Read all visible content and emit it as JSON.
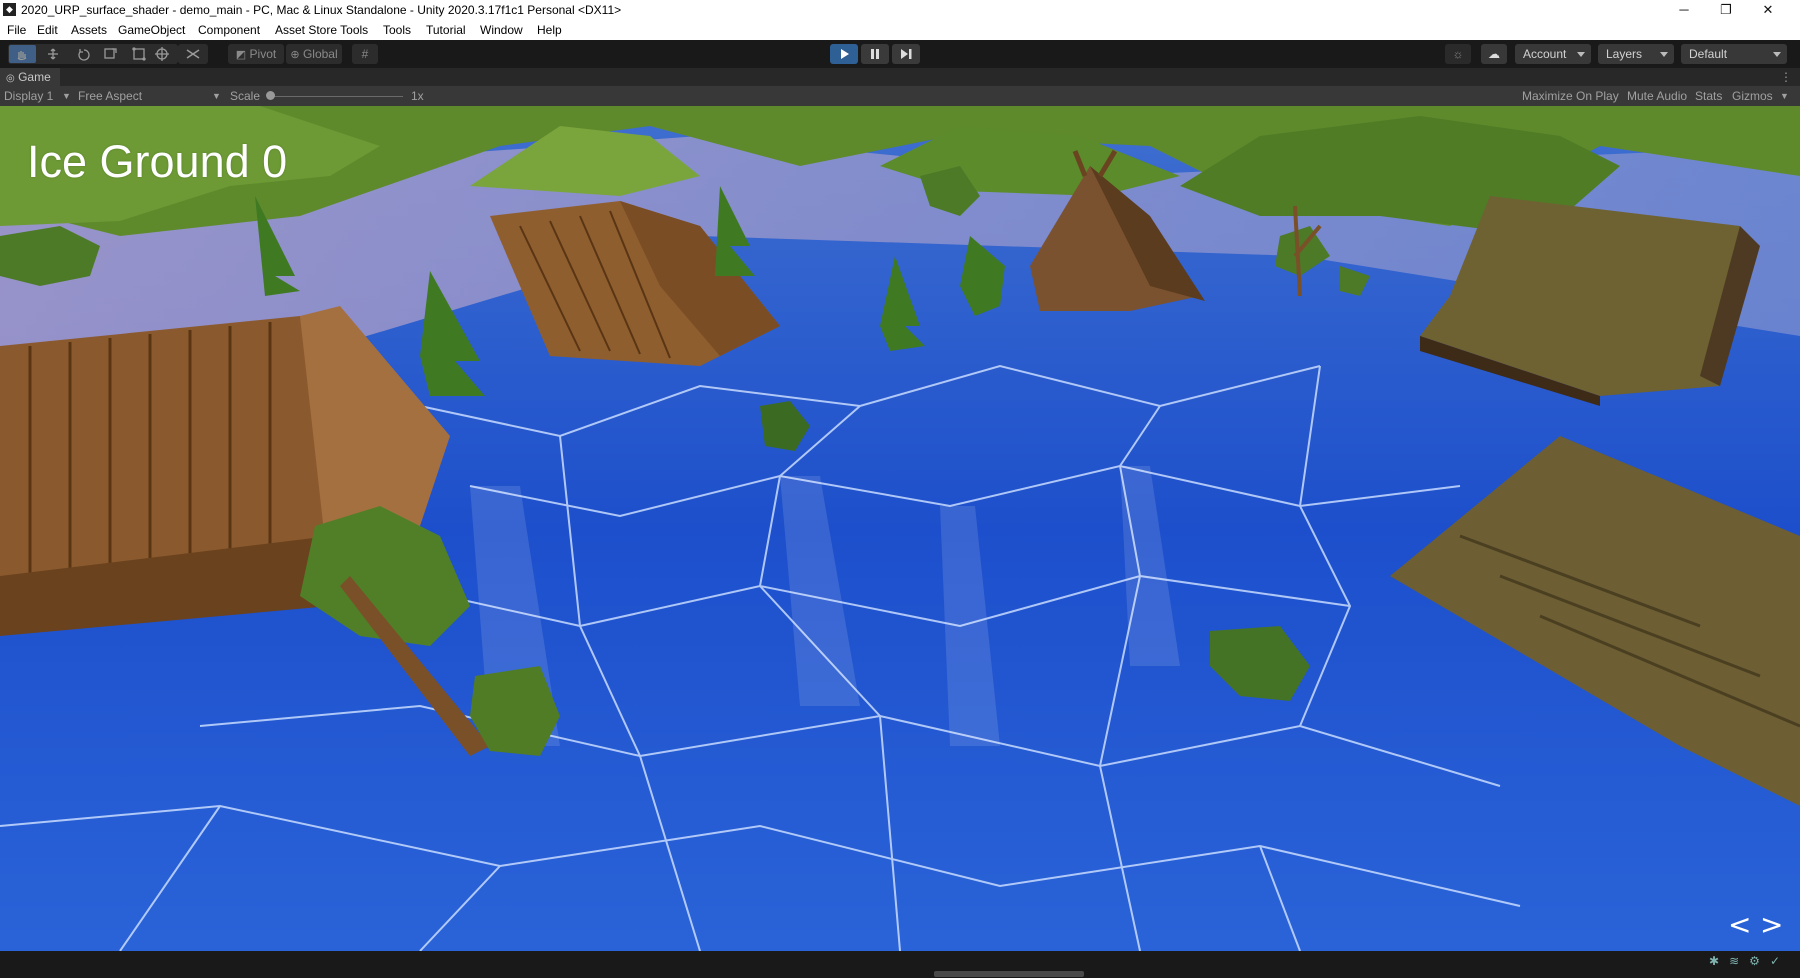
{
  "window": {
    "title": "2020_URP_surface_shader - demo_main - PC, Mac & Linux Standalone - Unity 2020.3.17f1c1 Personal <DX11>",
    "minimize": "─",
    "maximize": "❐",
    "close": "✕"
  },
  "menu": [
    "File",
    "Edit",
    "Assets",
    "GameObject",
    "Component",
    "Asset Store Tools",
    "Tools",
    "Tutorial",
    "Window",
    "Help"
  ],
  "toolbar": {
    "pivot_label": "Pivot",
    "global_label": "Global",
    "account_label": "Account",
    "layers_label": "Layers",
    "layout_label": "Default"
  },
  "game_tab": {
    "label": "Game",
    "display": "Display 1",
    "aspect": "Free Aspect",
    "scale_label": "Scale",
    "scale_value": "1x",
    "maximize_on_play": "Maximize On Play",
    "mute_audio": "Mute Audio",
    "stats": "Stats",
    "gizmos": "Gizmos"
  },
  "game_view": {
    "hud_title": "Ice Ground 0",
    "prev_arrow": "<",
    "next_arrow": ">"
  },
  "colors": {
    "play_active": "#2e5f95",
    "ice": "#1f55c8",
    "grass": "#5b8a2a"
  }
}
